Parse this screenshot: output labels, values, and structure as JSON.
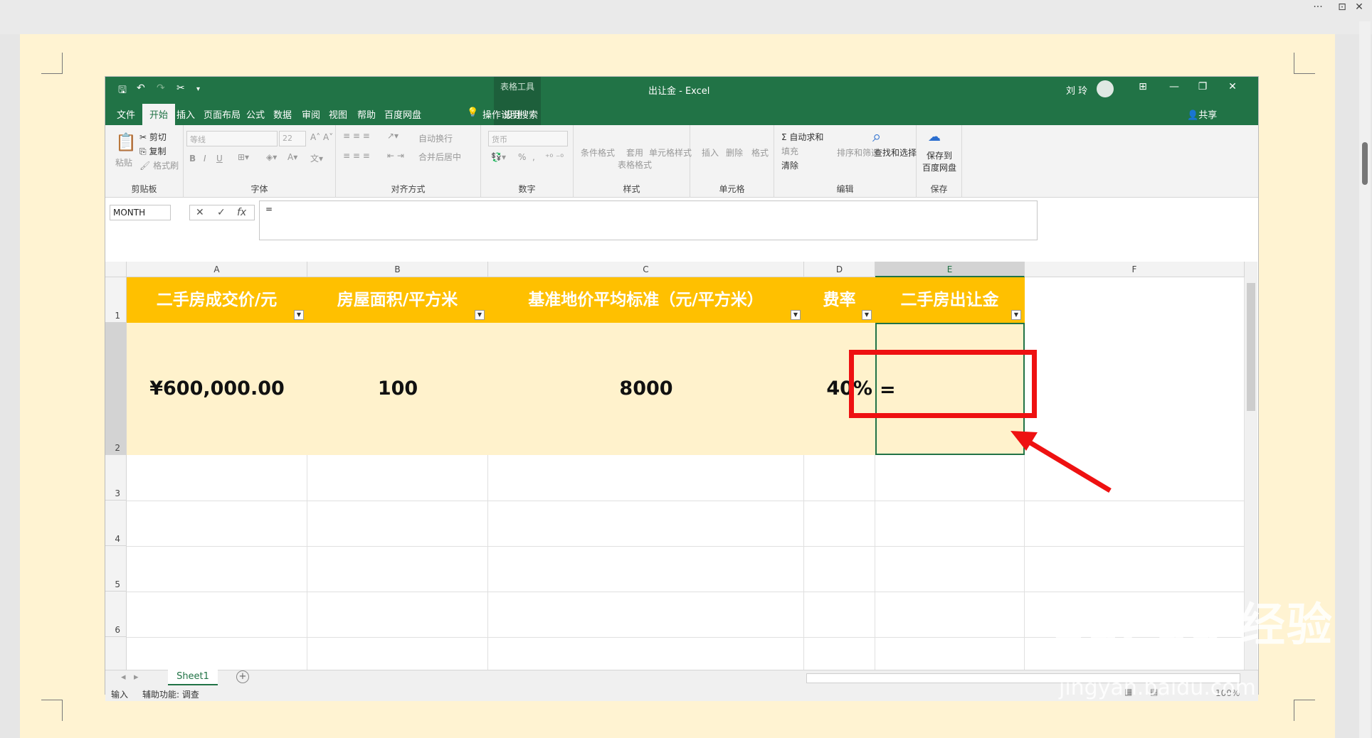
{
  "window": {
    "more": "···",
    "restore": "⊡",
    "close": "✕"
  },
  "qa": {
    "save": "🖫",
    "undo": "↶",
    "redo": "↷",
    "cut": "✂",
    "more": "▾"
  },
  "title": {
    "context": "表格工具",
    "doc": "出让金 - Excel",
    "user": "刘 玲",
    "ribbon_opts": "⊞",
    "minimize": "—",
    "restore": "❐",
    "close": "✕"
  },
  "tabs": [
    "文件",
    "开始",
    "插入",
    "页面布局",
    "公式",
    "数据",
    "审阅",
    "视图",
    "帮助",
    "百度网盘",
    "设计"
  ],
  "tell_me": "操作说明搜索",
  "share": "共享",
  "ribbon": {
    "clipboard": {
      "paste": "粘贴",
      "cut": "剪切",
      "copy": "复制",
      "format_painter": "格式刷",
      "label": "剪贴板"
    },
    "font": {
      "name": "等线",
      "size": "22",
      "label": "字体",
      "bold": "B",
      "italic": "I",
      "underline": "U",
      "grow": "A˄",
      "shrink": "A˅"
    },
    "align": {
      "wrap": "自动换行",
      "merge": "合并后居中",
      "label": "对齐方式"
    },
    "number": {
      "format": "货币",
      "percent": "%",
      "comma": ",",
      "label": "数字"
    },
    "styles": {
      "conditional": "条件格式",
      "table": "套用\n表格格式",
      "cell": "单元格样式",
      "label": "样式"
    },
    "cells": {
      "insert": "插入",
      "delete": "删除",
      "format": "格式",
      "label": "单元格"
    },
    "editing": {
      "autosum": "自动求和",
      "fill": "填充",
      "clear": "清除",
      "sort": "排序和筛选",
      "find": "查找和选择",
      "label": "编辑"
    },
    "save": {
      "save_to": "保存到\n百度网盘",
      "label": "保存"
    }
  },
  "formula_bar": {
    "name_box": "MONTH",
    "cancel": "✕",
    "enter": "✓",
    "fx": "fx",
    "formula": "="
  },
  "columns": [
    "A",
    "B",
    "C",
    "D",
    "E",
    "F"
  ],
  "rows": [
    "1",
    "2",
    "3",
    "4",
    "5",
    "6"
  ],
  "headers": [
    "二手房成交价/元",
    "房屋面积/平方米",
    "基准地价平均标准（元/平方米）",
    "费率",
    "二手房出让金"
  ],
  "data_row": [
    "¥600,000.00",
    "100",
    "8000",
    "40%",
    "="
  ],
  "sheet": {
    "name": "Sheet1",
    "add": "+"
  },
  "status": {
    "mode": "输入",
    "accessibility": "辅助功能: 调查",
    "zoom": "100%"
  },
  "watermark": {
    "main": "Bai du 经验",
    "sub": "jingyan.baidu.com"
  }
}
